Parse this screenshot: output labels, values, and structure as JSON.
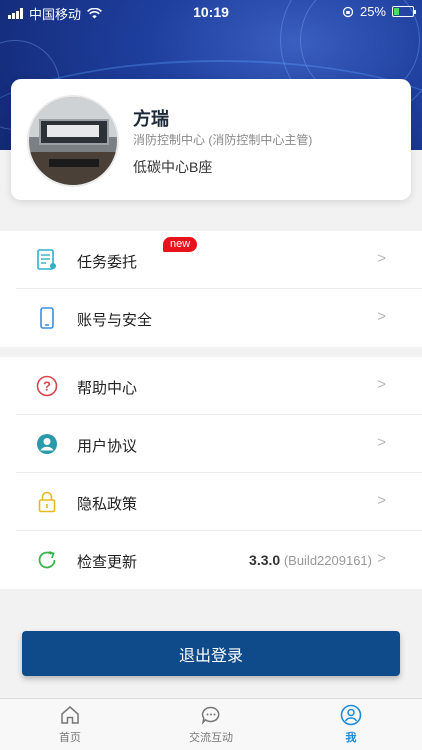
{
  "status_bar": {
    "carrier": "中国移动",
    "time": "10:19",
    "battery_percent": "25%",
    "battery_level": 0.25
  },
  "profile": {
    "name": "方瑞",
    "department": "消防控制中心 (消防控制中心主管)",
    "location": "低碳中心B座"
  },
  "menu_group_1": [
    {
      "label": "任务委托",
      "icon": "task-document-icon",
      "badge": "new"
    },
    {
      "label": "账号与安全",
      "icon": "phone-icon"
    }
  ],
  "menu_group_2": [
    {
      "label": "帮助中心",
      "icon": "help-icon"
    },
    {
      "label": "用户协议",
      "icon": "user-icon"
    },
    {
      "label": "隐私政策",
      "icon": "lock-icon"
    },
    {
      "label": "检查更新",
      "icon": "refresh-icon",
      "version": "3.3.0",
      "build": "(Build2209161)"
    }
  ],
  "logout_label": "退出登录",
  "tabbar": [
    {
      "label": "首页",
      "icon": "home-icon"
    },
    {
      "label": "交流互动",
      "icon": "chat-icon"
    },
    {
      "label": "我",
      "icon": "profile-icon",
      "active": true
    }
  ],
  "colors": {
    "accent": "#0f4a8a",
    "active_tab": "#1a8cd8",
    "badge": "#e8121a"
  }
}
